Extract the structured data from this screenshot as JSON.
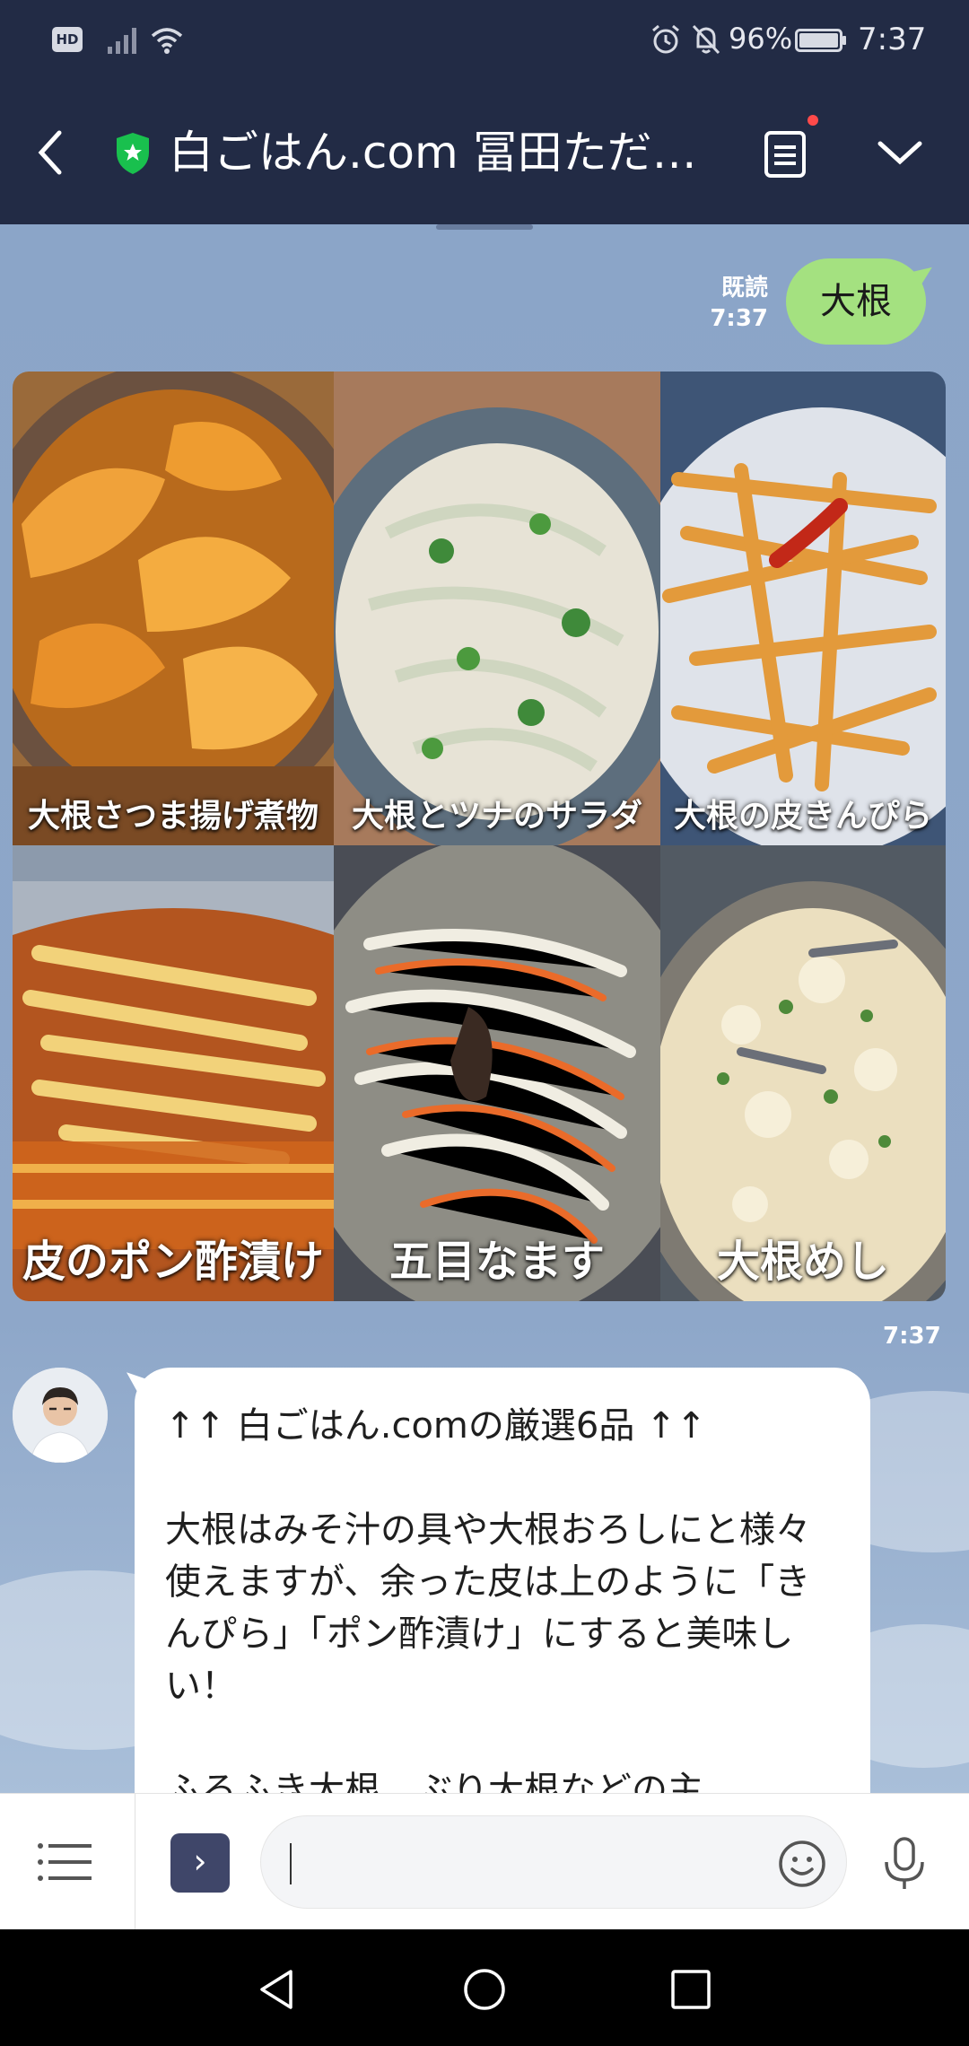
{
  "status_bar": {
    "hd_badge": "HD",
    "battery_percent": "96%",
    "time": "7:37",
    "icons": [
      "signal-icon",
      "wifi-icon",
      "alarm-icon",
      "bell-muted-icon",
      "battery-icon"
    ]
  },
  "header": {
    "title": "白ごはん.com 冨田ただ…",
    "icons": [
      "back-icon",
      "verified-shield-icon",
      "notes-icon",
      "chevron-down-icon"
    ]
  },
  "chat": {
    "outgoing": {
      "read_label": "既読",
      "time": "7:37",
      "text": "大根"
    },
    "recipe_grid": {
      "time": "7:37",
      "tiles": [
        {
          "label": "大根さつま揚げ煮物"
        },
        {
          "label": "大根とツナのサラダ"
        },
        {
          "label": "大根の皮きんぴら"
        },
        {
          "label": "皮のポン酢漬け"
        },
        {
          "label": "五目なます"
        },
        {
          "label": "大根めし"
        }
      ]
    },
    "incoming": {
      "lines": [
        "↑↑ 白ごはん.comの厳選6品 ↑↑",
        "大根はみそ汁の具や大根おろしにと様々使えますが、余った皮は上のように「きんぴら」「ポン酢漬け」にすると美味しい！",
        "ふろふき大根、ぶり大根などの主"
      ]
    }
  },
  "input_bar": {
    "placeholder": "",
    "expand_glyph": "›",
    "icons": [
      "menu-icon",
      "expand-icon",
      "emoji-icon",
      "mic-icon"
    ]
  },
  "nav_bar": {
    "icons": [
      "back-triangle-icon",
      "home-circle-icon",
      "recents-square-icon"
    ]
  },
  "colors": {
    "header_bg": "#222b45",
    "chat_bg": "#8ba5c8",
    "outgoing_bubble": "#a4e180",
    "incoming_bubble": "#ffffff"
  }
}
